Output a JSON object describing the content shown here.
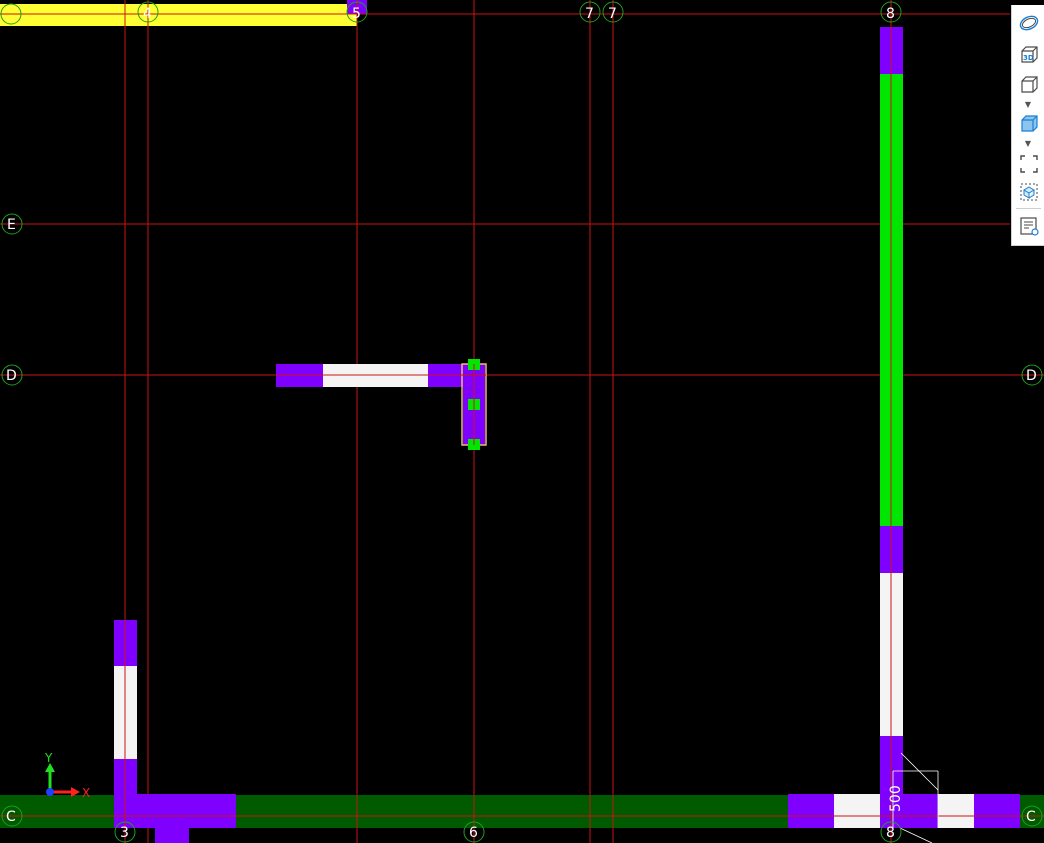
{
  "canvas": {
    "background": "#000000",
    "grid_color": "#c81414",
    "bubble_color": "#1e9e1e"
  },
  "axes": {
    "vertical": [
      "3",
      "4",
      "5",
      "6",
      "7",
      "7",
      "8"
    ],
    "horizontal": [
      "E",
      "D",
      "C"
    ],
    "bottom_labels": [
      "3",
      "6",
      "8"
    ],
    "top_labels": [
      "4",
      "5",
      "7",
      "7",
      "8"
    ]
  },
  "colors": {
    "purple": "#8000ff",
    "white": "#f4f4f4",
    "bright_green": "#00e600",
    "dark_green": "#005a00",
    "yellow": "#ffff33",
    "selection_outline": "#e8c060",
    "grip": "#00e600"
  },
  "dimension": {
    "text": "500"
  },
  "ucs": {
    "x_label": "X",
    "y_label": "Y",
    "x_color": "#ff2020",
    "y_color": "#20e020",
    "origin_color": "#2040ff"
  },
  "toolbar": {
    "buttons": [
      {
        "name": "orbit-icon",
        "label": ""
      },
      {
        "name": "3d-view-icon",
        "label": "3D"
      },
      {
        "name": "view-cube-icon",
        "label": ""
      },
      {
        "name": "shaded-cube-icon",
        "label": ""
      },
      {
        "name": "zoom-extents-icon",
        "label": ""
      },
      {
        "name": "zoom-selection-icon",
        "label": ""
      },
      {
        "name": "properties-list-icon",
        "label": ""
      }
    ],
    "accent": "#1a7fd4"
  }
}
